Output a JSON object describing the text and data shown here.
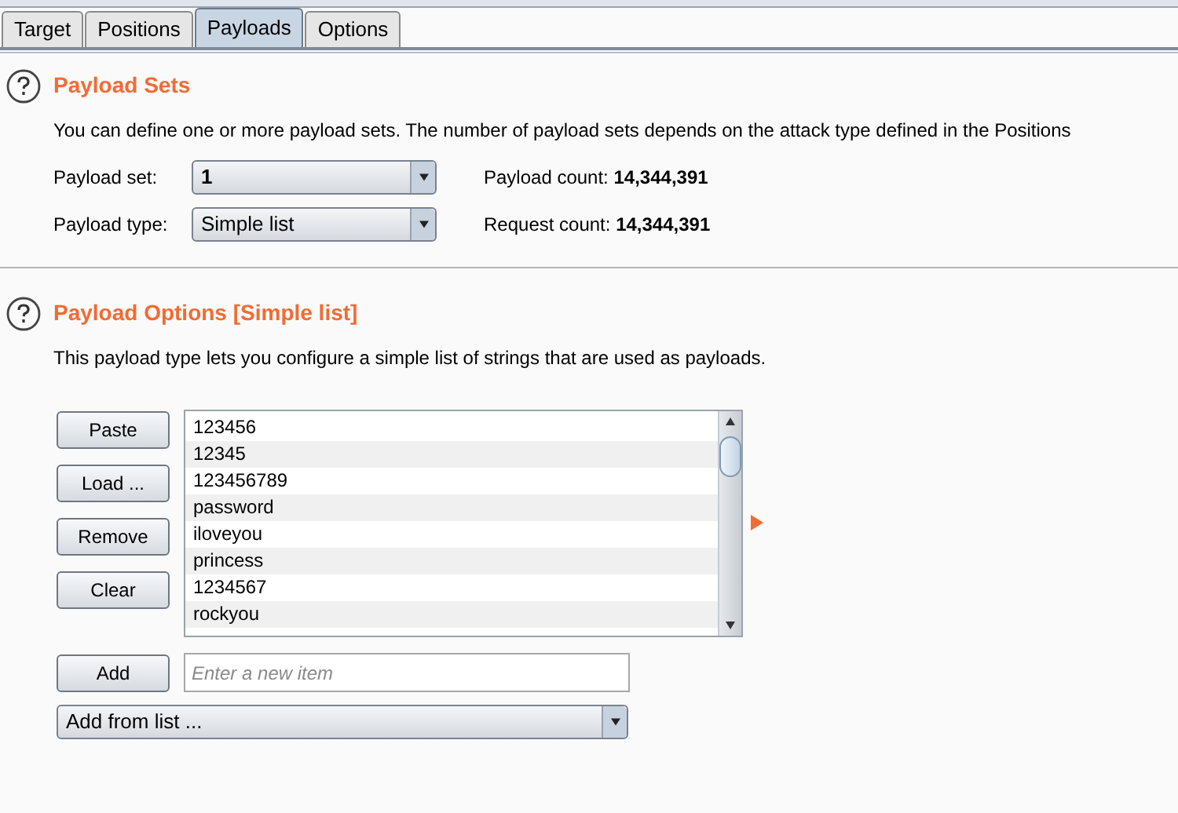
{
  "tabs": [
    {
      "label": "Target",
      "selected": false
    },
    {
      "label": "Positions",
      "selected": false
    },
    {
      "label": "Payloads",
      "selected": true
    },
    {
      "label": "Options",
      "selected": false
    }
  ],
  "payload_sets": {
    "title": "Payload Sets",
    "description": "You can define one or more payload sets. The number of payload sets depends on the attack type defined in the Positions",
    "payload_set": {
      "label": "Payload set:",
      "value": "1"
    },
    "payload_type": {
      "label": "Payload type:",
      "value": "Simple list"
    },
    "payload_count": {
      "label": "Payload count:",
      "value": "14,344,391"
    },
    "request_count": {
      "label": "Request count:",
      "value": "14,344,391"
    }
  },
  "payload_options": {
    "title": "Payload Options [Simple list]",
    "description": "This payload type lets you configure a simple list of strings that are used as payloads.",
    "buttons": [
      "Paste",
      "Load ...",
      "Remove",
      "Clear"
    ],
    "items": [
      "123456",
      "12345",
      "123456789",
      "password",
      "iloveyou",
      "princess",
      "1234567",
      "rockyou"
    ],
    "add_button": "Add",
    "new_item": {
      "placeholder": "Enter a new item"
    },
    "add_from_list": "Add from list ..."
  }
}
